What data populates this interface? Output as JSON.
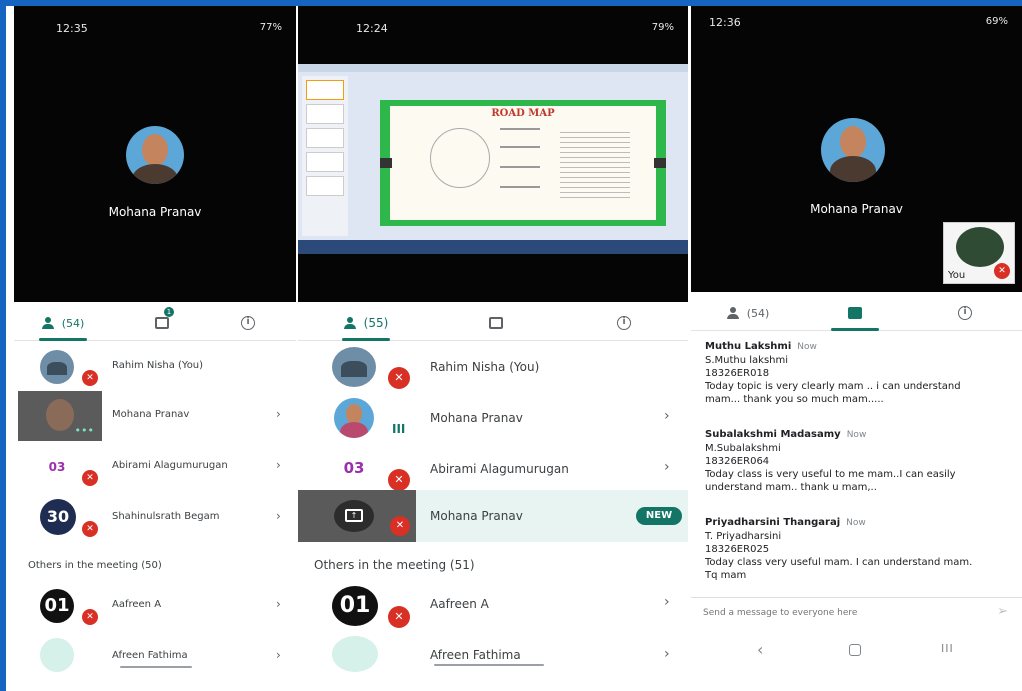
{
  "left_panel": {
    "status": {
      "time": "12:35",
      "battery": "77%"
    },
    "caller_name": "Mohana Pranav",
    "tabs": {
      "people_count": "(54)",
      "chat_badge": "1"
    },
    "participants": [
      {
        "name": "Rahim Nisha (You)"
      },
      {
        "name": "Mohana Pranav"
      },
      {
        "name": "Abirami Alagumurugan",
        "avatar_text": "03"
      },
      {
        "name": "Shahinulsrath Begam",
        "avatar_text": "30"
      }
    ],
    "others_header": "Others in the meeting (50)",
    "others": [
      {
        "name": "Aafreen A",
        "avatar_text": "01"
      },
      {
        "name": "Afreen Fathima"
      }
    ]
  },
  "middle_panel": {
    "status": {
      "time": "12:24",
      "battery": "79%"
    },
    "slide_title": "ROAD MAP",
    "tabs": {
      "people_count": "(55)"
    },
    "participants": [
      {
        "name": "Rahim Nisha (You)"
      },
      {
        "name": "Mohana Pranav"
      },
      {
        "name": "Abirami Alagumurugan",
        "avatar_text": "03"
      },
      {
        "name": "Mohana Pranav",
        "badge": "NEW"
      }
    ],
    "others_header": "Others in the meeting (51)",
    "others": [
      {
        "name": "Aafreen A",
        "avatar_text": "01"
      },
      {
        "name": "Afreen Fathima"
      }
    ]
  },
  "right_panel": {
    "status": {
      "time": "12:36",
      "battery": "69%"
    },
    "caller_name": "Mohana Pranav",
    "self_label": "You",
    "tabs": {
      "people_count": "(54)"
    },
    "messages": [
      {
        "sender": "Muthu Lakshmi",
        "when": "Now",
        "lines": [
          "S.Muthu lakshmi",
          "18326ER018",
          "Today topic is very clearly mam .. i can understand",
          "mam... thank you so much mam....."
        ]
      },
      {
        "sender": "Subalakshmi Madasamy",
        "when": "Now",
        "lines": [
          "M.Subalakshmi",
          "18326ER064",
          "Today class is very useful to me mam..I can easily",
          "understand mam.. thank u mam,.."
        ]
      },
      {
        "sender": "Priyadharsini Thangaraj",
        "when": "Now",
        "lines": [
          "T. Priyadharsini",
          "18326ER025",
          "Today class very useful mam. I can understand  mam.",
          "Tq mam"
        ]
      }
    ],
    "composer_placeholder": "Send a message to everyone here"
  },
  "colors": {
    "accent": "#137566",
    "mute": "#d93025",
    "frame": "#1565c0"
  }
}
